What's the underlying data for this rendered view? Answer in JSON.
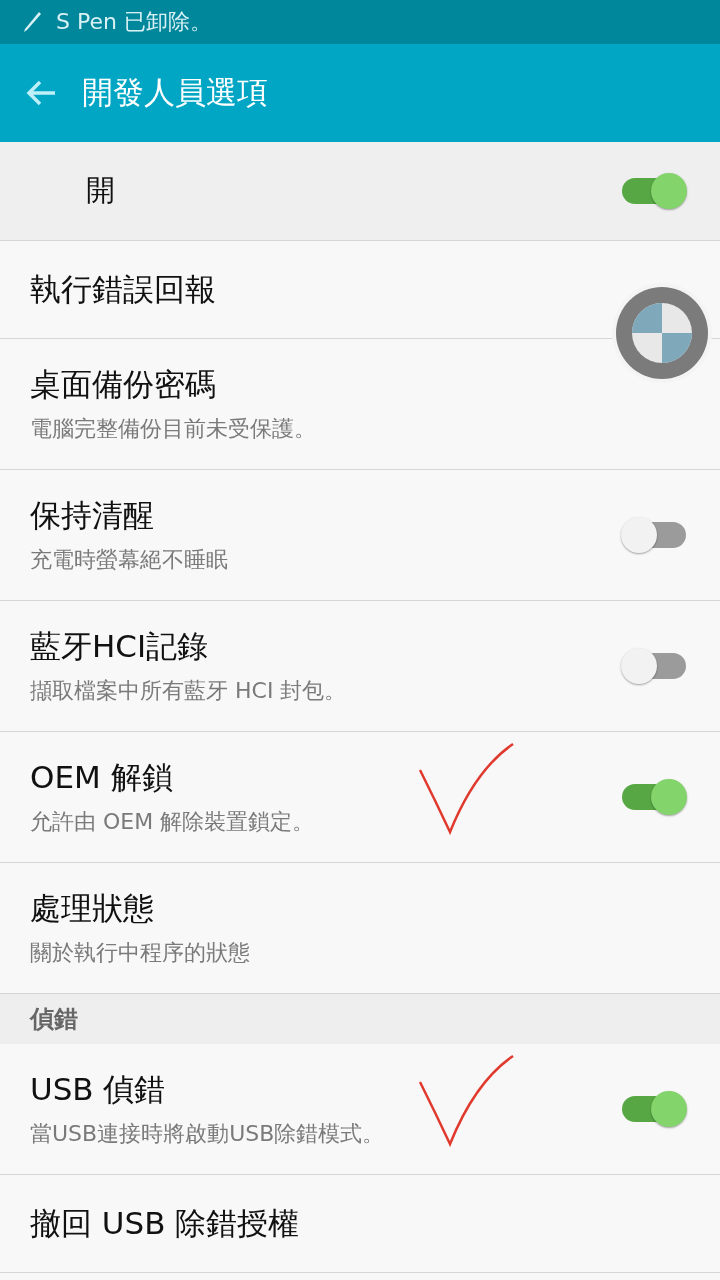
{
  "status_bar": {
    "notification": "S Pen 已卸除。"
  },
  "toolbar": {
    "title": "開發人員選項"
  },
  "master_switch": {
    "label": "開",
    "on": true
  },
  "sections": [
    {
      "items": [
        {
          "kind": "plain",
          "title": "執行錯誤回報",
          "hand_check": false
        },
        {
          "kind": "plain",
          "title": "桌面備份密碼",
          "subtitle": "電腦完整備份目前未受保護。",
          "hand_check": false
        },
        {
          "kind": "switch",
          "title": "保持清醒",
          "subtitle": "充電時螢幕絕不睡眠",
          "on": false,
          "hand_check": false
        },
        {
          "kind": "switch",
          "title": "藍牙HCI記錄",
          "subtitle": "擷取檔案中所有藍牙 HCI 封包。",
          "on": false,
          "hand_check": false
        },
        {
          "kind": "switch",
          "title": "OEM 解鎖",
          "subtitle": "允許由 OEM 解除裝置鎖定。",
          "on": true,
          "hand_check": true
        },
        {
          "kind": "plain",
          "title": "處理狀態",
          "subtitle": "關於執行中程序的狀態",
          "hand_check": false
        }
      ]
    },
    {
      "header": "偵錯",
      "items": [
        {
          "kind": "switch",
          "title": "USB 偵錯",
          "subtitle": "當USB連接時將啟動USB除錯模式。",
          "on": true,
          "hand_check": true
        },
        {
          "kind": "plain",
          "title": "撤回 USB 除錯授權",
          "hand_check": false
        }
      ]
    }
  ]
}
